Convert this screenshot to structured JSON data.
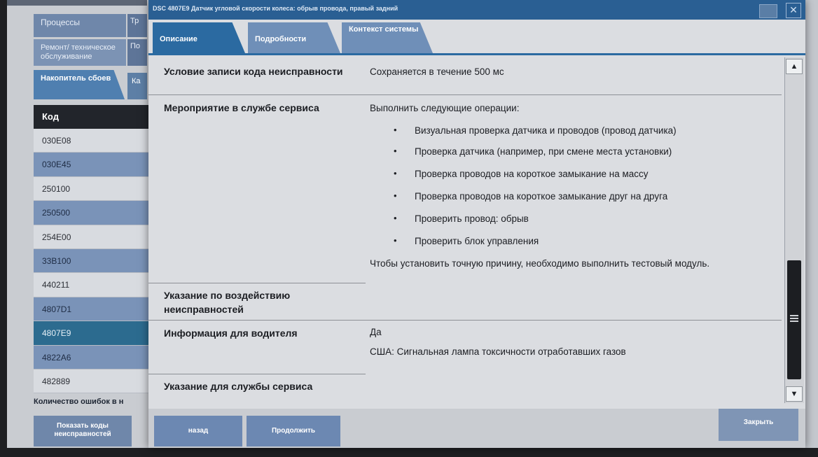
{
  "background": {
    "nav": {
      "processes": "Процессы",
      "processes_side": "Тр",
      "repair": "Ремонт/ техническое обслуживание",
      "repair_side": "По"
    },
    "subtab": {
      "label": "Накопитель сбоев",
      "side": "Ка"
    },
    "table": {
      "header": "Код",
      "rows": [
        "030E08",
        "030E45",
        "250100",
        "250500",
        "254E00",
        "33B100",
        "440211",
        "4807D1",
        "4807E9",
        "4822A6",
        "482889"
      ],
      "selected": "4807E9"
    },
    "count_label": "Количество ошибок в н",
    "show_codes_button": "Показать коды неисправностей"
  },
  "dialog": {
    "title": "DSC 4807E9 Датчик угловой скорости колеса: обрыв провода, правый задний",
    "tabs": [
      "Описание",
      "Подробности",
      "Контекст системы"
    ],
    "active_tab": "Описание",
    "rows": {
      "condition_label": "Условие записи кода неисправности",
      "condition_value": "Сохраняется в течение 500 мс",
      "service_label": "Мероприятие в службе сервиса",
      "service_intro": "Выполнить следующие операции:",
      "service_steps": [
        "Визуальная проверка датчика и проводов (провод датчика)",
        "Проверка датчика (например, при смене места установки)",
        "Проверка проводов на короткое замыкание на массу",
        "Проверка проводов на короткое замыкание друг на друга",
        "Проверить провод: обрыв",
        "Проверить блок управления"
      ],
      "service_outro": "Чтобы установить точную причину, необходимо выполнить тестовый модуль.",
      "impact_label": "Указание по воздействию неисправностей",
      "driver_label": "Информация для водителя",
      "driver_value_1": "Да",
      "driver_value_2": "США: Сигнальная лампа токсичности отработавших газов",
      "service_hint_label": "Указание для службы сервиса"
    },
    "buttons": {
      "back": "назад",
      "continue": "Продолжить",
      "close": "Закрыть"
    }
  }
}
